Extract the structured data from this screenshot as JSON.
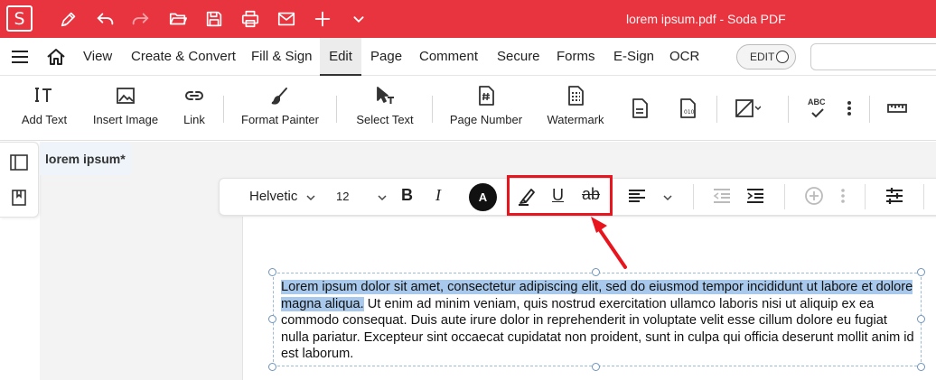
{
  "app": {
    "logo_letter": "S",
    "window_title": "lorem ipsum.pdf   -   Soda PDF",
    "brand_color": "#e8343f"
  },
  "quick_access": [
    {
      "name": "sign-pen-icon"
    },
    {
      "name": "undo-icon"
    },
    {
      "name": "redo-icon"
    },
    {
      "name": "open-folder-icon"
    },
    {
      "name": "save-icon"
    },
    {
      "name": "print-icon"
    },
    {
      "name": "mail-icon"
    },
    {
      "name": "new-icon"
    },
    {
      "name": "more-chevron-icon"
    }
  ],
  "menu": {
    "items": [
      "View",
      "Create & Convert",
      "Fill & Sign",
      "Edit",
      "Page",
      "Comment",
      "Secure",
      "Forms",
      "E-Sign",
      "OCR"
    ],
    "active": "Edit",
    "edit_toggle_label": "EDIT"
  },
  "ribbon": {
    "add_text": "Add Text",
    "insert_image": "Insert Image",
    "link": "Link",
    "format_painter": "Format Painter",
    "select_text": "Select Text",
    "page_number": "Page Number",
    "watermark": "Watermark",
    "spell_check_icon_text": "ABC"
  },
  "document": {
    "tab_title": "lorem ipsum",
    "tab_modified": "*"
  },
  "format_bar": {
    "font_family": "Helvetic",
    "font_size": "12",
    "bold": "B",
    "italic": "I",
    "color_letter": "A",
    "underline": "U",
    "strikethrough": "ab"
  },
  "textbox": {
    "selected_text": "Lorem ipsum dolor sit amet, consectetur adipiscing elit, sed do eiusmod tempor incididunt ut labore et dolore magna aliqua.",
    "rest_text": " Ut enim ad minim veniam, quis nostrud exercitation ullamco laboris nisi ut aliquip ex ea commodo consequat. Duis aute irure dolor in reprehenderit in voluptate velit esse cillum dolore eu fugiat nulla pariatur. Excepteur sint occaecat cupidatat non proident, sunt in culpa qui officia deserunt mollit anim id est laborum."
  }
}
